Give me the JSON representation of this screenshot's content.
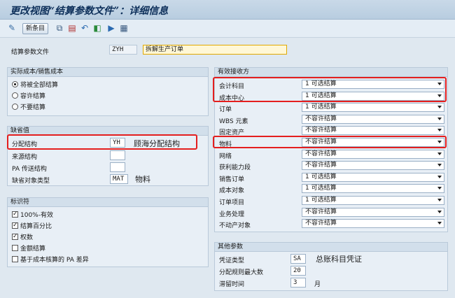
{
  "window": {
    "title": "更改视图“结算参数文件”：详细信息"
  },
  "toolbar": {
    "new_entries_label": "新条目"
  },
  "header": {
    "profile_label": "结算参数文件",
    "profile_code": "ZYH",
    "profile_desc": "拆解生产订单"
  },
  "actual_costs": {
    "title": "实际成本/销售成本",
    "options": [
      "将被全部结算",
      "容许结算",
      "不要结算"
    ],
    "selected": 0
  },
  "defaults": {
    "title": "缺省值",
    "alloc_structure_label": "分配结构",
    "alloc_structure_value": "YH",
    "alloc_structure_note": "顾海分配结构",
    "source_structure_label": "来源结构",
    "pa_transfer_label": "PA 传送结构",
    "default_obj_type_label": "缺省对象类型",
    "default_obj_type_value": "MAT",
    "default_obj_type_note": "物料"
  },
  "indicators": {
    "title": "标识符",
    "items": [
      {
        "label": "100%-有效",
        "checked": true
      },
      {
        "label": "结算百分比",
        "checked": true
      },
      {
        "label": "权数",
        "checked": true
      },
      {
        "label": "金额结算",
        "checked": false
      },
      {
        "label": "基于成本核算的 PA 差异",
        "checked": false
      }
    ]
  },
  "receivers": {
    "title": "有效接收方",
    "rows": [
      {
        "label": "会计科目",
        "value": "1 可选结算"
      },
      {
        "label": "成本中心",
        "value": "1 可选结算"
      },
      {
        "label": "订单",
        "value": "1 可选结算"
      },
      {
        "label": "WBS 元素",
        "value": "不容许结算"
      },
      {
        "label": "固定资产",
        "value": "不容许结算"
      },
      {
        "label": "物料",
        "value": "不容许结算"
      },
      {
        "label": "网络",
        "value": "不容许结算"
      },
      {
        "label": "获利能力段",
        "value": "不容许结算"
      },
      {
        "label": "销售订单",
        "value": "1 可选结算"
      },
      {
        "label": "成本对象",
        "value": "1 可选结算"
      },
      {
        "label": "订单项目",
        "value": "1 可选结算"
      },
      {
        "label": "业务处理",
        "value": "不容许结算"
      },
      {
        "label": "不动产对象",
        "value": "不容许结算"
      }
    ]
  },
  "other": {
    "title": "其他参数",
    "doc_type_label": "凭证类型",
    "doc_type_value": "SA",
    "doc_type_note": "总账科目凭证",
    "max_rules_label": "分配规则最大数",
    "max_rules_value": "20",
    "residence_label": "滞留时间",
    "residence_value": "3",
    "residence_unit": "月"
  }
}
